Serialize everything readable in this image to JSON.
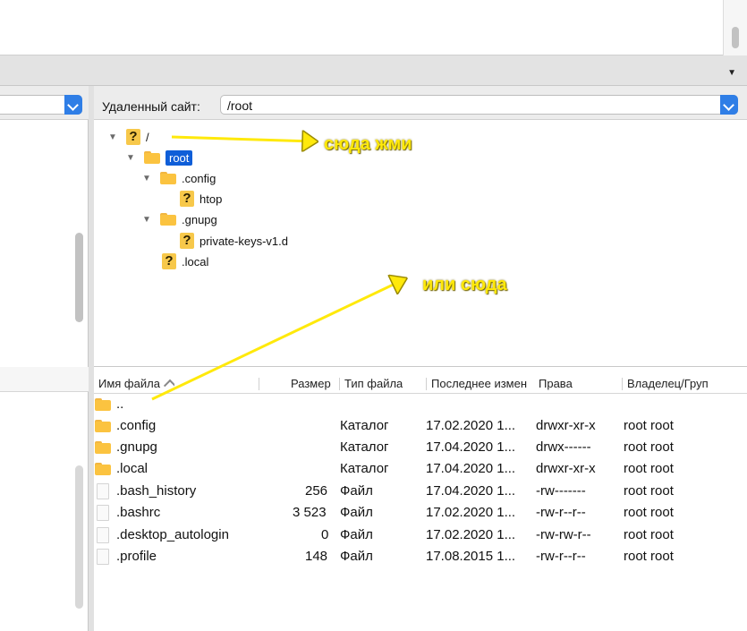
{
  "remote": {
    "label": "Удаленный сайт:",
    "path": "/root"
  },
  "tree": [
    {
      "name": "/",
      "icon": "question-icon",
      "expanded": true
    },
    {
      "name": "root",
      "icon": "folder-icon",
      "expanded": true,
      "selected": true
    },
    {
      "name": ".config",
      "icon": "folder-icon",
      "expanded": true
    },
    {
      "name": "htop",
      "icon": "question-icon"
    },
    {
      "name": ".gnupg",
      "icon": "folder-icon",
      "expanded": true
    },
    {
      "name": "private-keys-v1.d",
      "icon": "question-icon"
    },
    {
      "name": ".local",
      "icon": "question-icon"
    }
  ],
  "columns": {
    "name": "Имя файла",
    "size": "Размер",
    "type": "Тип файла",
    "modified": "Последнее измен",
    "perms": "Права",
    "owner": "Владелец/Груп"
  },
  "files": [
    {
      "name": "..",
      "size": "",
      "type": "",
      "modified": "",
      "perms": "",
      "owner": "",
      "icon": "folder-icon"
    },
    {
      "name": ".config",
      "size": "",
      "type": "Каталог",
      "modified": "17.02.2020 1...",
      "perms": "drwxr-xr-x",
      "owner": "root root",
      "icon": "folder-icon"
    },
    {
      "name": ".gnupg",
      "size": "",
      "type": "Каталог",
      "modified": "17.04.2020 1...",
      "perms": "drwx------",
      "owner": "root root",
      "icon": "folder-icon"
    },
    {
      "name": ".local",
      "size": "",
      "type": "Каталог",
      "modified": "17.04.2020 1...",
      "perms": "drwxr-xr-x",
      "owner": "root root",
      "icon": "folder-icon"
    },
    {
      "name": ".bash_history",
      "size": "256",
      "type": "Файл",
      "modified": "17.04.2020 1...",
      "perms": "-rw-------",
      "owner": "root root",
      "icon": "file-icon"
    },
    {
      "name": ".bashrc",
      "size": "3 523",
      "type": "Файл",
      "modified": "17.02.2020 1...",
      "perms": "-rw-r--r--",
      "owner": "root root",
      "icon": "file-icon"
    },
    {
      "name": ".desktop_autologin",
      "size": "0",
      "type": "Файл",
      "modified": "17.02.2020 1...",
      "perms": "-rw-rw-r--",
      "owner": "root root",
      "icon": "file-icon"
    },
    {
      "name": ".profile",
      "size": "148",
      "type": "Файл",
      "modified": "17.08.2015 1...",
      "perms": "-rw-r--r--",
      "owner": "root root",
      "icon": "file-icon"
    }
  ],
  "annotations": {
    "click_here": "сюда жми",
    "or_here": "или сюда",
    "color": "#ffe90b"
  },
  "colors": {
    "selection": "#0f5ed8",
    "combo_button": "#2f7ee6",
    "folder": "#fbc340"
  }
}
